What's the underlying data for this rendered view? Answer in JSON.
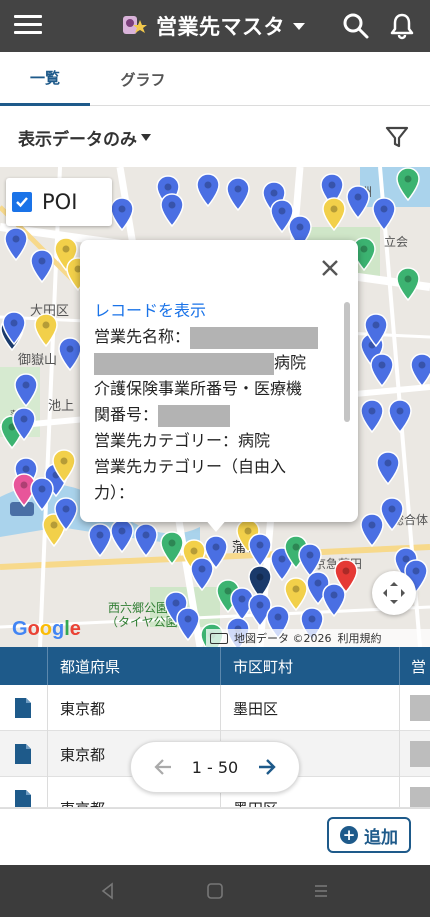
{
  "header": {
    "title": "営業先マスタ",
    "icons": [
      "menu-icon",
      "app-logo-icon",
      "chevron-down-icon",
      "search-icon",
      "bell-icon"
    ]
  },
  "tabs": [
    {
      "label": "一覧",
      "active": true
    },
    {
      "label": "グラフ",
      "active": false
    }
  ],
  "filter": {
    "selected": "表示データのみ",
    "icon": "filter-icon"
  },
  "map": {
    "poi_label": "POI",
    "poi_checked": true,
    "labels": [
      "大田区",
      "蒲",
      "大田区",
      "御嶽山",
      "池上",
      "立会",
      "品",
      "洲",
      "蒲田",
      "京急蒲田",
      "西六郷公園",
      "（タイヤ公園）",
      "総合体"
    ],
    "google": "Google",
    "attribution": {
      "data": "地図データ ©2026",
      "terms": "利用規約"
    },
    "colors": {
      "blue_pin": "#4a6fe3",
      "yellow_pin": "#f2d04a",
      "green_pin": "#3cb371",
      "red_pin": "#e53935",
      "pink_pin": "#e8559a",
      "navy_pin": "#1a3a6b"
    }
  },
  "popup": {
    "link": "レコードを表示",
    "line1": "営業先名称：",
    "line2_suffix": "病院",
    "line3": "介護保険事業所番号・医療機",
    "line4": "関番号：",
    "line5": "営業先カテゴリー：病院",
    "line6": "営業先カテゴリー（自由入",
    "line7": "力）："
  },
  "table": {
    "headers": [
      "都道府県",
      "市区町村",
      "営"
    ],
    "rows": [
      {
        "prefecture": "東京都",
        "city": "墨田区"
      },
      {
        "prefecture": "東京都",
        "city": ""
      },
      {
        "prefecture": "東京都",
        "city": "墨田区"
      }
    ]
  },
  "pager": {
    "range": "1 - 50"
  },
  "actions": {
    "add_label": "追加"
  },
  "theme": {
    "header_bg": "#444444",
    "accent": "#1e5a8a"
  }
}
